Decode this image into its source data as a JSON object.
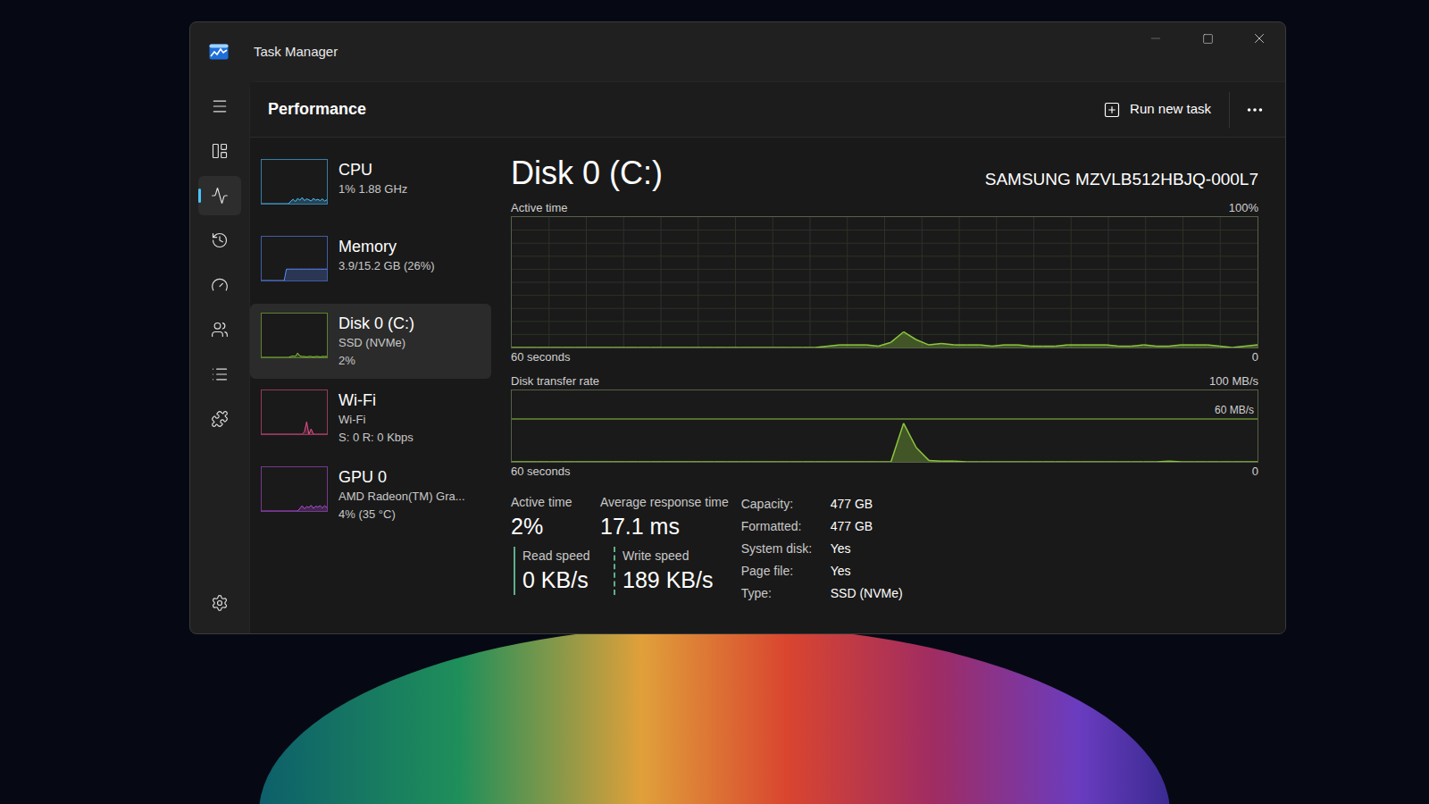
{
  "window": {
    "title": "Task Manager"
  },
  "nav": {
    "items": [
      {
        "kind": "processes",
        "selected": false
      },
      {
        "kind": "performance",
        "selected": true
      },
      {
        "kind": "history",
        "selected": false
      },
      {
        "kind": "startup",
        "selected": false
      },
      {
        "kind": "users",
        "selected": false
      },
      {
        "kind": "details",
        "selected": false
      },
      {
        "kind": "services",
        "selected": false
      }
    ]
  },
  "header": {
    "title": "Performance",
    "run_new_task": "Run new task"
  },
  "devices": [
    {
      "name": "CPU",
      "lines": [
        "1% 1.88 GHz"
      ],
      "selected": false,
      "color": "#4cc2ff",
      "graph": [
        0,
        0,
        0,
        0,
        0,
        0,
        0,
        0,
        0,
        0,
        0,
        0,
        0,
        6,
        10,
        5,
        12,
        8,
        14,
        7,
        11,
        9,
        6,
        12,
        8,
        10,
        7,
        11,
        6,
        9
      ]
    },
    {
      "name": "Memory",
      "lines": [
        "3.9/15.2 GB (26%)"
      ],
      "selected": false,
      "color": "#5a8cff",
      "graph": [
        0,
        0,
        0,
        0,
        0,
        0,
        0,
        0,
        0,
        0,
        0,
        26,
        26,
        26,
        26,
        26,
        26,
        26,
        26,
        26,
        26,
        26,
        26,
        26,
        26,
        26,
        26,
        26,
        26,
        26
      ]
    },
    {
      "name": "Disk 0 (C:)",
      "lines": [
        "SSD (NVMe)",
        "2%"
      ],
      "selected": true,
      "color": "#8cc63f",
      "graph": [
        0,
        0,
        0,
        0,
        0,
        0,
        0,
        0,
        0,
        0,
        0,
        0,
        0,
        2,
        3,
        2,
        10,
        3,
        2,
        2,
        1,
        2,
        2,
        1,
        2,
        2,
        1,
        2,
        2,
        2
      ]
    },
    {
      "name": "Wi-Fi",
      "lines": [
        "Wi-Fi",
        "S: 0 R: 0 Kbps"
      ],
      "selected": false,
      "color": "#e64f8a",
      "graph": [
        0,
        0,
        0,
        0,
        0,
        0,
        0,
        0,
        0,
        0,
        0,
        0,
        0,
        0,
        0,
        0,
        0,
        0,
        0,
        5,
        28,
        0,
        12,
        0,
        0,
        0,
        0,
        0,
        0,
        0
      ]
    },
    {
      "name": "GPU 0",
      "lines": [
        "AMD Radeon(TM) Gra...",
        "4% (35 °C)"
      ],
      "selected": false,
      "color": "#b44fe0",
      "graph": [
        0,
        0,
        0,
        0,
        0,
        0,
        0,
        0,
        0,
        0,
        0,
        0,
        0,
        0,
        0,
        0,
        0,
        6,
        12,
        5,
        10,
        8,
        13,
        6,
        11,
        9,
        12,
        7,
        12,
        8
      ]
    }
  ],
  "detail": {
    "title": "Disk 0 (C:)",
    "model": "SAMSUNG MZVLB512HBJQ-000L7",
    "active_chart": {
      "title": "Active time",
      "max_label": "100%",
      "max": 100,
      "x_start": "60 seconds",
      "x_end": "0",
      "color": "#8cc63f",
      "values": [
        0,
        0,
        0,
        0,
        0,
        0,
        0,
        0,
        0,
        0,
        0,
        0,
        0,
        0,
        0,
        0,
        0,
        0,
        0,
        0,
        0,
        0,
        0,
        0,
        0,
        1,
        2,
        2,
        2,
        1,
        4,
        12,
        6,
        2,
        3,
        2,
        2,
        2,
        1,
        2,
        2,
        1,
        1,
        1,
        2,
        2,
        2,
        2,
        1,
        1,
        2,
        1,
        1,
        2,
        2,
        2,
        1,
        0,
        1,
        2
      ]
    },
    "transfer_chart": {
      "title": "Disk transfer rate",
      "max_label": "100 MB/s",
      "max": 100,
      "reference": {
        "value": 60,
        "label": "60 MB/s"
      },
      "x_start": "60 seconds",
      "x_end": "0",
      "color": "#8cc63f",
      "values": [
        0,
        0,
        0,
        0,
        0,
        0,
        0,
        0,
        0,
        0,
        0,
        0,
        0,
        0,
        0,
        0,
        0,
        0,
        0,
        0,
        0,
        0,
        0,
        0,
        0,
        0,
        0,
        0,
        0,
        0,
        0,
        54,
        20,
        2,
        1,
        1,
        0,
        0,
        0,
        0,
        0,
        0,
        0,
        0,
        0,
        0,
        0,
        0,
        0,
        0,
        0,
        0,
        1,
        0,
        0,
        0,
        0,
        0,
        0,
        0
      ]
    },
    "stats": [
      {
        "label": "Active time",
        "value": "2%"
      },
      {
        "label": "Average response time",
        "value": "17.1 ms"
      }
    ],
    "speeds": [
      {
        "label": "Read speed",
        "value": "0 KB/s",
        "kind": "read"
      },
      {
        "label": "Write speed",
        "value": "189 KB/s",
        "kind": "write"
      }
    ],
    "properties": [
      {
        "label": "Capacity:",
        "value": "477 GB"
      },
      {
        "label": "Formatted:",
        "value": "477 GB"
      },
      {
        "label": "System disk:",
        "value": "Yes"
      },
      {
        "label": "Page file:",
        "value": "Yes"
      },
      {
        "label": "Type:",
        "value": "SSD (NVMe)"
      }
    ]
  }
}
